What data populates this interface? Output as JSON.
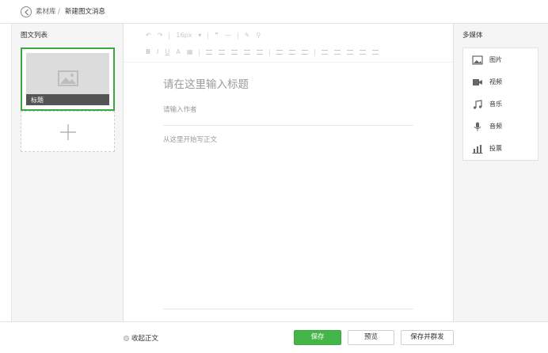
{
  "breadcrumb": {
    "back_icon": "chevron-left-icon",
    "parent": "素材库",
    "separator": "/",
    "current": "新建图文消息"
  },
  "article_list": {
    "title": "图文列表",
    "items": [
      {
        "title": "标题",
        "cover_icon": "image-placeholder-icon",
        "selected": true
      }
    ],
    "add_icon": "plus-icon"
  },
  "toolbar": {
    "row1": [
      "↶",
      "↷",
      "16px",
      "❞",
      "—",
      "✎",
      "⚲"
    ],
    "row2": [
      "B",
      "I",
      "U",
      "A",
      "▦",
      "≡",
      "≡",
      "≡",
      "≡",
      "≣",
      "≣",
      "≣",
      "☰",
      "☰",
      "⋮",
      "⋮",
      "⋮"
    ],
    "font_size": "16px"
  },
  "editor": {
    "title_placeholder": "请在这里输入标题",
    "title_value": "",
    "author_placeholder": "请输入作者",
    "author_value": "",
    "body_placeholder": "从这里开始写正文",
    "body_value": ""
  },
  "media": {
    "title": "多媒体",
    "items": [
      {
        "label": "图片",
        "icon": "image-icon"
      },
      {
        "label": "视频",
        "icon": "video-icon"
      },
      {
        "label": "音乐",
        "icon": "music-icon"
      },
      {
        "label": "音频",
        "icon": "microphone-icon"
      },
      {
        "label": "投票",
        "icon": "poll-icon"
      }
    ]
  },
  "footer": {
    "collapse_label": "收起正文",
    "save_label": "保存",
    "preview_label": "预览",
    "save_send_label": "保存并群发"
  },
  "colors": {
    "accent": "#44b549",
    "selected_border": "#3fa63f",
    "panel_bg": "#f5f5f5",
    "placeholder_text": "#9a9a9a"
  }
}
